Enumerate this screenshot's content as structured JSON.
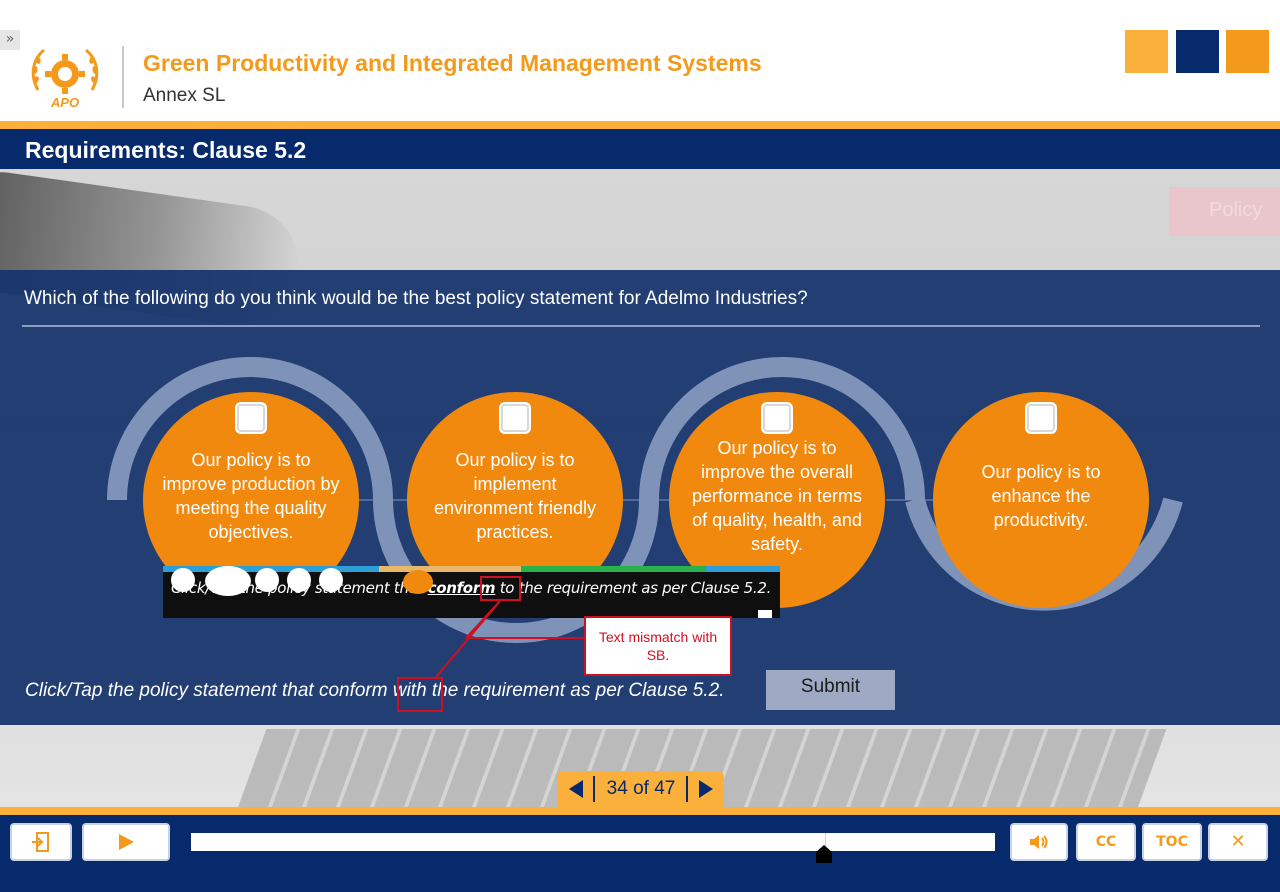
{
  "header": {
    "collapse_glyph": "»",
    "logo_text": "APO",
    "course_title": "Green Productivity and Integrated Management Systems",
    "course_subtitle": "Annex SL",
    "accent_squares": [
      "#fbb03b",
      "#062a6b",
      "#f39a1c"
    ]
  },
  "slide": {
    "title": "Requirements: Clause 5.2",
    "ghost_tab": "Policy"
  },
  "question": {
    "prompt": "Which of the following do you think would be the best policy statement for Adelmo Industries?",
    "options": [
      {
        "label": "Our policy is to improve production by meeting the quality objectives.",
        "checked": false
      },
      {
        "label": "Our policy is to implement environment friendly practices.",
        "checked": false
      },
      {
        "label": "Our policy is to improve the overall performance in terms of quality, health, and safety.",
        "checked": false
      },
      {
        "label": "Our policy is to enhance the productivity.",
        "checked": false
      }
    ],
    "instruction": "Click/Tap the policy statement that conform with the requirement as per Clause 5.2.",
    "submit_label": "Submit"
  },
  "review": {
    "inset_prefix": "Click/Tap the policy statement that ",
    "inset_emphasis": "conform",
    "inset_suffix": " to the requirement as per Clause 5.2.",
    "callout": "Text mismatch with SB.",
    "callout_color": "#d01020"
  },
  "navigation": {
    "counter": "34 of 47",
    "current": 34,
    "total": 47
  },
  "player": {
    "exit_icon": "exit-icon",
    "play_icon": "play-icon",
    "volume_icon": "volume-icon",
    "cc_label": "CC",
    "toc_label": "TOC",
    "close_glyph": "✕",
    "progress": 0.79
  },
  "colors": {
    "orange": "#f0890e",
    "navy": "#062a6b",
    "gold": "#fbb03b"
  }
}
